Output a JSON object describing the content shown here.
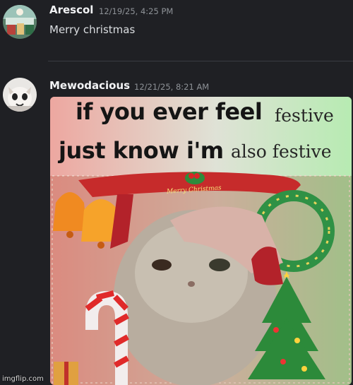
{
  "messages": [
    {
      "author": "Arescol",
      "timestamp": "12/19/25, 4:25 PM",
      "text": "Merry christmas"
    },
    {
      "author": "Mewodacious",
      "timestamp": "12/21/25, 8:21 AM",
      "attachment": {
        "caption_bold_line1": "if you ever feel",
        "caption_serif_line1": "festive",
        "caption_bold_line2": "just know i'm",
        "caption_serif_line2": "also festive",
        "banner_text": "Merry Christmas"
      }
    }
  ],
  "watermark": "imgflip.com",
  "colors": {
    "background": "#1f2024",
    "author": "#f2f3f5",
    "timestamp": "#8e9297",
    "text": "#dbdee1"
  }
}
